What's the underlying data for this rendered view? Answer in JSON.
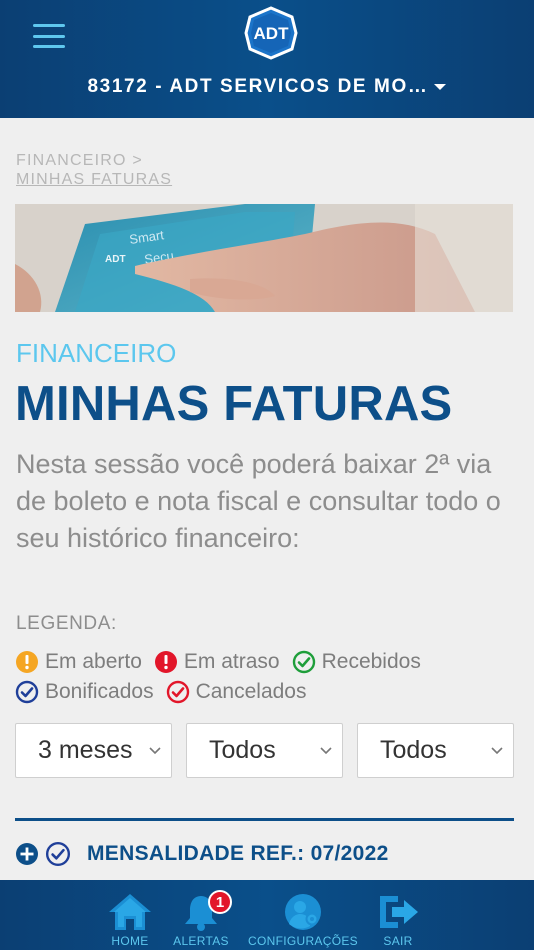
{
  "header": {
    "logo_text": "ADT",
    "account": "83172 - ADT SERVICOS DE MO…"
  },
  "breadcrumb": {
    "parent": "FINANCEIRO >",
    "current": "MINHAS FATURAS"
  },
  "hero": {
    "device_text_1": "Smart",
    "device_text_2": "Secu",
    "device_logo": "ADT"
  },
  "page": {
    "section": "FINANCEIRO",
    "title": "MINHAS FATURAS",
    "intro": "Nesta sessão você poderá baixar 2ª via de boleto e nota fiscal e consultar todo o seu histórico financeiro:"
  },
  "legend": {
    "title": "LEGENDA:",
    "items": [
      {
        "label": "Em aberto",
        "icon": "warning-icon",
        "color": "#f5a623"
      },
      {
        "label": "Em atraso",
        "icon": "alert-icon",
        "color": "#e2162a"
      },
      {
        "label": "Recebidos",
        "icon": "check-circle-icon",
        "color": "#1e9e3a"
      },
      {
        "label": "Bonificados",
        "icon": "check-circle-icon",
        "color": "#1f3f99"
      },
      {
        "label": "Cancelados",
        "icon": "check-circle-icon",
        "color": "#e2162a"
      }
    ]
  },
  "filters": {
    "period": "3 meses",
    "status": "Todos",
    "type": "Todos"
  },
  "invoice": {
    "title": "MENSALIDADE REF.: 07/2022"
  },
  "nav": {
    "home": "HOME",
    "alerts": "ALERTAS",
    "alerts_count": "1",
    "config": "CONFIGURAÇÕES",
    "exit": "SAIR"
  },
  "colors": {
    "brand_dark": "#0b3f73",
    "accent": "#5cc7ee",
    "title_blue": "#0d4f89"
  }
}
